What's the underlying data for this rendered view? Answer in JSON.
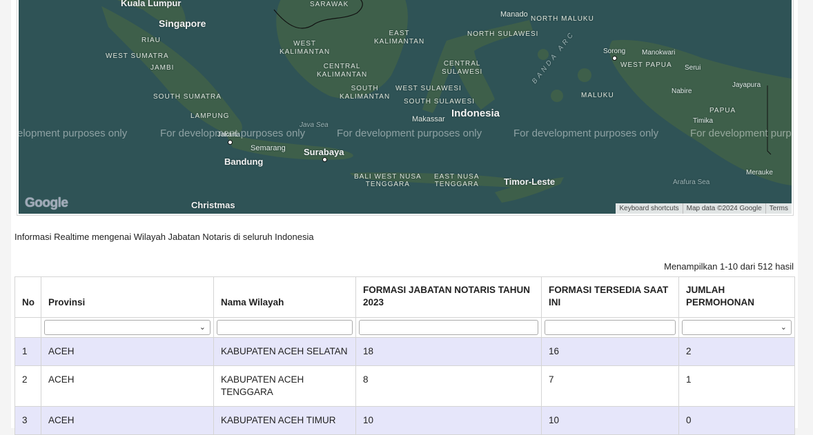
{
  "map": {
    "labels": {
      "kuala_lumpur": "Kuala Lumpur",
      "singapore": "Singapore",
      "riau": "RIAU",
      "west_sumatra": "WEST SUMATRA",
      "jambi": "JAMBI",
      "south_sumatra": "SOUTH SUMATRA",
      "lampung": "LAMPUNG",
      "jakarta": "Jakarta",
      "bandung": "Bandung",
      "semarang": "Semarang",
      "surabaya": "Surabaya",
      "christmas": "Christmas",
      "java_sea": "Java Sea",
      "sarawak": "SARAWAK",
      "west_kalimantan": "WEST\nKALIMANTAN",
      "east_kalimantan": "EAST\nKALIMANTAN",
      "central_kalimantan": "CENTRAL\nKALIMANTAN",
      "south_kalimantan": "SOUTH\nKALIMANTAN",
      "west_sulawesi": "WEST SULAWESI",
      "central_sulawesi": "CENTRAL\nSULAWESI",
      "south_sulawesi": "SOUTH SULAWESI",
      "north_sulawesi": "NORTH SULAWESI",
      "manado": "Manado",
      "north_maluku": "NORTH MALUKU",
      "sorong": "Sorong",
      "manokwari": "Manokwari",
      "west_papua": "WEST PAPUA",
      "serui": "Serui",
      "jayapura": "Jayapura",
      "nabire": "Nabire",
      "papua": "PAPUA",
      "timika": "Timika",
      "maluku": "MALUKU",
      "banda_arc": "BANDA ARC",
      "makassar": "Makassar",
      "indonesia": "Indonesia",
      "bali_ntb": "BALI WEST NUSA\nTENGGARA",
      "ntt": "EAST NUSA\nTENGGARA",
      "timor_leste": "Timor-Leste",
      "arafura": "Arafura Sea",
      "merauke": "Merauke"
    },
    "dev_watermark": "For development purposes only",
    "dev_watermark_partial": "elopment purposes only",
    "dev_watermark_tail": "For development purpo",
    "google_logo": "Google",
    "attribution": {
      "shortcuts": "Keyboard shortcuts",
      "map_data": "Map data ©2024 Google",
      "terms": "Terms"
    }
  },
  "info_text": "Informasi Realtime mengenai Wilayah Jabatan Notaris di seluruh Indonesia",
  "summary": "Menampilkan 1-10 dari 512 hasil",
  "table": {
    "headers": {
      "no": "No",
      "provinsi": "Provinsi",
      "nama_wilayah": "Nama Wilayah",
      "formasi_2023": "FORMASI JABATAN NOTARIS TAHUN 2023",
      "formasi_tersedia": "FORMASI TERSEDIA SAAT INI",
      "jumlah": "JUMLAH PERMOHONAN"
    },
    "filters": {
      "provinsi": "",
      "nama_wilayah": "",
      "formasi_2023": "",
      "formasi_tersedia": "",
      "jumlah": ""
    },
    "rows": [
      {
        "no": "1",
        "provinsi": "ACEH",
        "wilayah": "KABUPATEN ACEH SELATAN",
        "formasi": "18",
        "tersedia": "16",
        "jumlah": "2"
      },
      {
        "no": "2",
        "provinsi": "ACEH",
        "wilayah": "KABUPATEN ACEH TENGGARA",
        "formasi": "8",
        "tersedia": "7",
        "jumlah": "1"
      },
      {
        "no": "3",
        "provinsi": "ACEH",
        "wilayah": "KABUPATEN ACEH TIMUR",
        "formasi": "10",
        "tersedia": "10",
        "jumlah": "0"
      }
    ]
  }
}
